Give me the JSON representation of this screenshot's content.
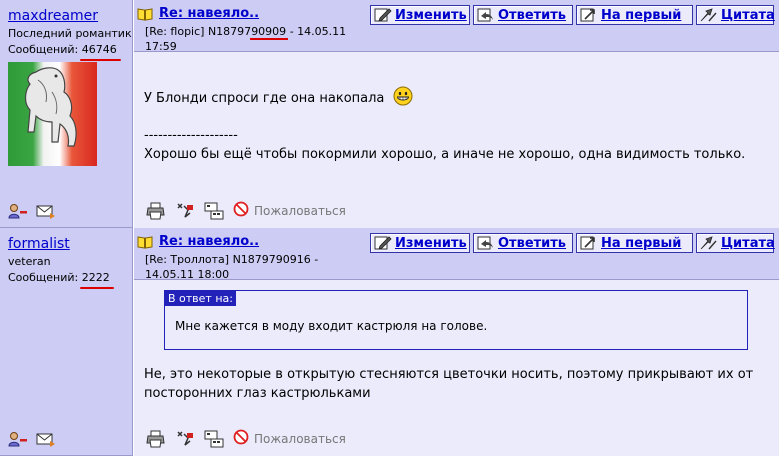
{
  "posts": [
    {
      "user": {
        "name": "maxdreamer",
        "status": "Последний романтик",
        "count_label": "Сообщений:",
        "count": "46746",
        "has_avatar": true
      },
      "title": "Re: навеяло..",
      "meta": {
        "ref": "[Re: flopic]",
        "id_prefix": "N18797",
        "id_highlight": "90909",
        "date": "- 14.05.11 17:59"
      },
      "body": {
        "line1": "У Блонди спроси где она накопала",
        "separator": "--------------------",
        "line2": "Хорошо бы ещё чтобы покормили хорошо, а иначе не хорошо, одна видимость только."
      }
    },
    {
      "user": {
        "name": "formalist",
        "status": "veteran",
        "count_label": "Сообщений:",
        "count": "2222",
        "has_avatar": false
      },
      "title": "Re: навеяло..",
      "meta": {
        "ref": "[Re: Троллота]",
        "id_prefix": "N1879790916",
        "id_highlight": "",
        "date": "- 14.05.11 18:00"
      },
      "quote": {
        "label": "В ответ на:",
        "text": "Мне кажется в моду входит кастрюля на голове."
      },
      "body": {
        "line1": "Не, это некоторые в открытую стесняются цветочки носить, поэтому прикрывают их от посторонних глаз кастрюльками"
      }
    }
  ],
  "buttons": {
    "edit": "Изменить",
    "reply": "Ответить",
    "to_first": "На первый",
    "quote": "Цитата"
  },
  "footer": {
    "complain": "Пожаловаться"
  },
  "colors": {
    "header_bg": "#ccccf4",
    "body_bg": "#ebebfc",
    "link": "#0000cc",
    "quote_border": "#2222bb",
    "underline_marker": "#dd0000"
  },
  "icons": [
    "book-icon",
    "edit-icon",
    "reply-icon",
    "first-icon",
    "quote-icon",
    "remove-user-icon",
    "mail-icon",
    "print-icon",
    "sign-icon",
    "tree-icon",
    "complain-icon",
    "grin-smiley-icon"
  ]
}
